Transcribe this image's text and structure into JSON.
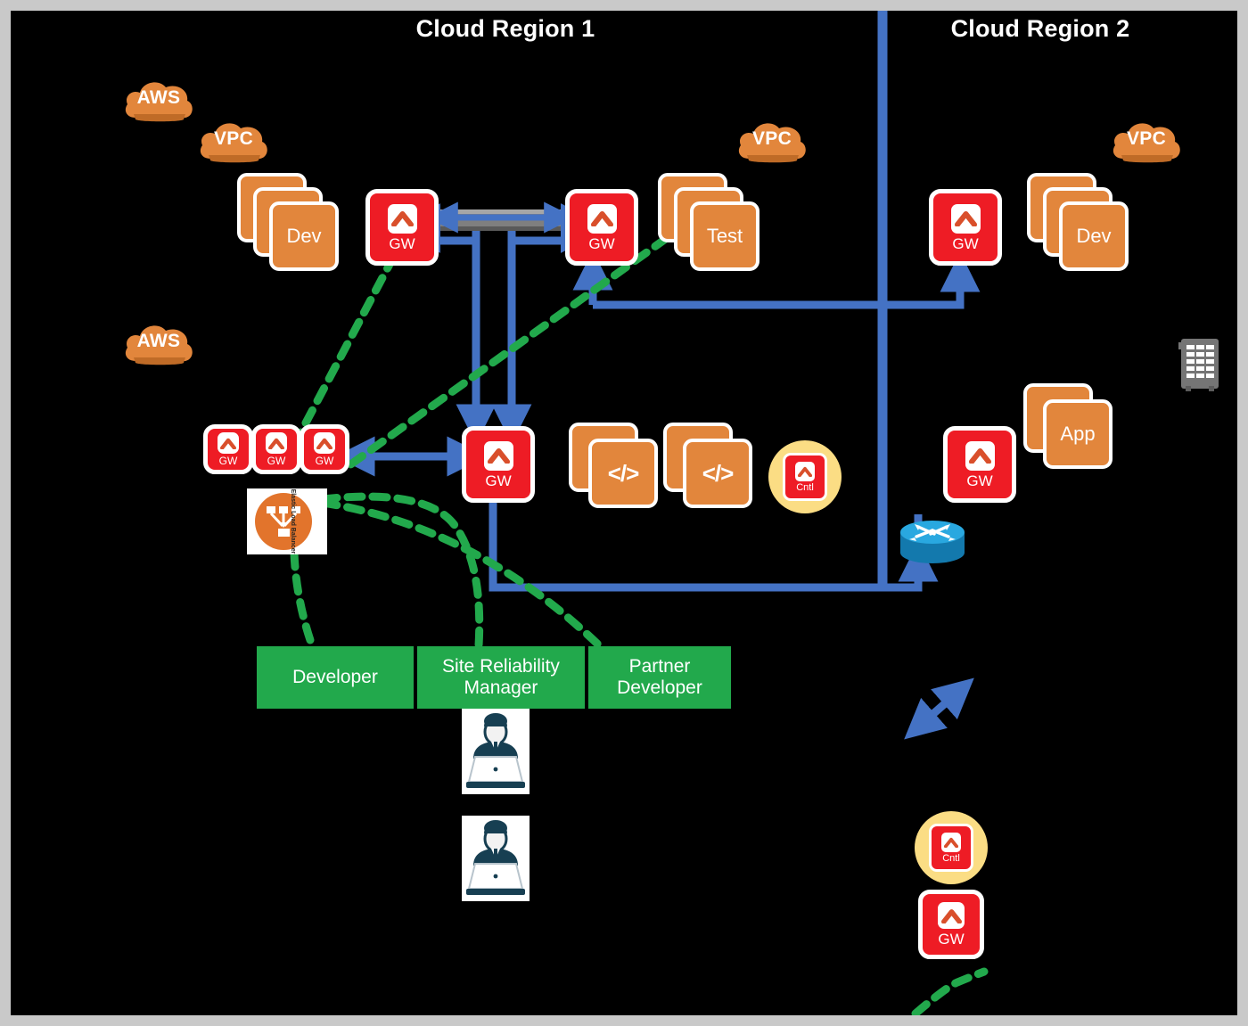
{
  "diagram": {
    "title_left": "Cloud Region 1",
    "title_right": "Cloud Region 2",
    "background": "#000000",
    "frame_color": "#c9c9c9"
  },
  "colors": {
    "gateway_red": "#ee1c25",
    "app_orange": "#e2863c",
    "cloud_orange": "#e2863c",
    "role_green": "#22a94c",
    "control_link_green": "#22a94c",
    "data_link_blue": "#4472c4",
    "controller_bubble_yellow": "#fbdd84",
    "router_blue": "#1b9ad6",
    "tunnel_grey": "#7f7f7f",
    "rack_grey": "#6e6e6e",
    "person_navy": "#173f52"
  },
  "clouds": [
    {
      "id": "aws-1",
      "label": "AWS"
    },
    {
      "id": "vpc-1",
      "label": "VPC"
    },
    {
      "id": "aws-2",
      "label": "AWS"
    },
    {
      "id": "vpc-2",
      "label": "VPC"
    },
    {
      "id": "vpc-3",
      "label": "VPC"
    }
  ],
  "workload_stacks": [
    {
      "id": "dev-r1",
      "label": "Dev",
      "cards": 3
    },
    {
      "id": "test-r1",
      "label": "Test",
      "cards": 3
    },
    {
      "id": "code-1",
      "label": "</>",
      "cards": 2
    },
    {
      "id": "code-2",
      "label": "</>",
      "cards": 2
    },
    {
      "id": "dev-r2",
      "label": "Dev",
      "cards": 3
    },
    {
      "id": "app-r2",
      "label": "App",
      "cards": 2
    }
  ],
  "gateways": [
    {
      "id": "gw-dev-r1",
      "label": "GW"
    },
    {
      "id": "gw-tunnel-r1",
      "label": "GW"
    },
    {
      "id": "gw-cluster-1",
      "label": "GW"
    },
    {
      "id": "gw-cluster-2",
      "label": "GW"
    },
    {
      "id": "gw-cluster-3",
      "label": "GW"
    },
    {
      "id": "gw-center-r1",
      "label": "GW"
    },
    {
      "id": "gw-dev-r2",
      "label": "GW"
    },
    {
      "id": "gw-app-r2",
      "label": "GW"
    },
    {
      "id": "gw-legend",
      "label": "GW"
    }
  ],
  "controllers": [
    {
      "id": "cntl-r1",
      "label": "Cntl"
    },
    {
      "id": "cntl-legend",
      "label": "Cntl"
    }
  ],
  "load_balancer": {
    "id": "elastic-load-balancer",
    "label": "Elastic Load Balancer"
  },
  "roles": [
    {
      "id": "role-developer",
      "label": "Developer"
    },
    {
      "id": "role-sre",
      "label": "Site Reliability\nManager",
      "line1": "Site Reliability",
      "line2": "Manager"
    },
    {
      "id": "role-partner-developer",
      "label": "Partner\nDeveloper",
      "line1": "Partner",
      "line2": "Developer"
    }
  ],
  "people": [
    {
      "id": "person-1",
      "label": "user-at-laptop"
    },
    {
      "id": "person-2",
      "label": "user-at-laptop"
    }
  ],
  "network_devices": [
    {
      "id": "router-r2",
      "label": "router"
    },
    {
      "id": "server-rack",
      "label": "datacenter-rack"
    }
  ],
  "legend": [
    {
      "id": "legend-data-path",
      "label": "data-path-arrow",
      "style": "blue solid arrow"
    },
    {
      "id": "legend-controller",
      "label": "Cntl",
      "style": "controller node"
    },
    {
      "id": "legend-gateway",
      "label": "GW",
      "style": "gateway node"
    },
    {
      "id": "legend-control-path",
      "label": "control-path-dashed",
      "style": "green dashed line"
    }
  ],
  "tunnel": {
    "id": "vpn-tunnel",
    "label": "encrypted-tunnel"
  }
}
